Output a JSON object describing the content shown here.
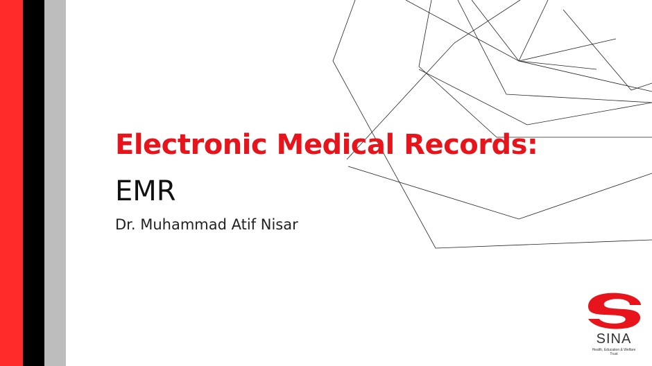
{
  "slide": {
    "title": "Electronic Medical Records:",
    "subtitle": "EMR",
    "author": "Dr. Muhammad Atif Nisar"
  },
  "logo": {
    "name": "SINA",
    "tagline": "Health, Education & Welfare Trust"
  },
  "colors": {
    "accent_red": "#e8141b",
    "stripe_red": "#ff2b2b",
    "stripe_black": "#000000",
    "stripe_gray": "#bdbdbd"
  }
}
